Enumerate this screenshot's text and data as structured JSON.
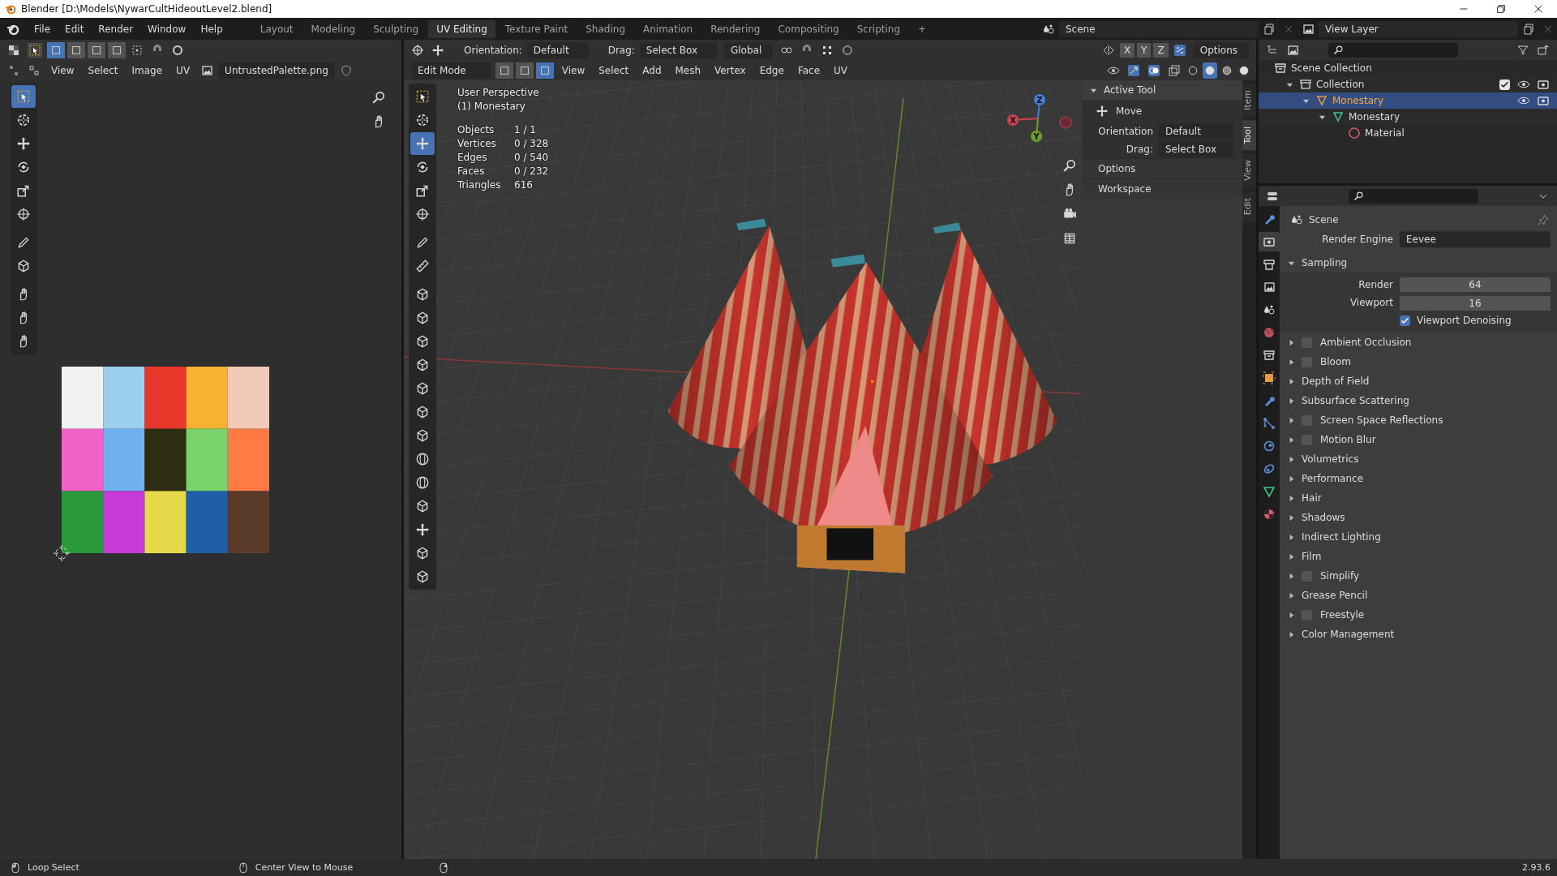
{
  "window": {
    "title": "Blender [D:\\Models\\NywarCultHideoutLevel2.blend]"
  },
  "menu": [
    "File",
    "Edit",
    "Render",
    "Window",
    "Help"
  ],
  "workspaces": [
    {
      "label": "Layout",
      "selected": false
    },
    {
      "label": "Modeling",
      "selected": false
    },
    {
      "label": "Sculpting",
      "selected": false
    },
    {
      "label": "UV Editing",
      "selected": true
    },
    {
      "label": "Texture Paint",
      "selected": false
    },
    {
      "label": "Shading",
      "selected": false
    },
    {
      "label": "Animation",
      "selected": false
    },
    {
      "label": "Rendering",
      "selected": false
    },
    {
      "label": "Compositing",
      "selected": false
    },
    {
      "label": "Scripting",
      "selected": false
    }
  ],
  "add_workspace": "+",
  "scene": "Scene",
  "view_layer": "View Layer",
  "uv_editor": {
    "menu": [
      "View",
      "Select",
      "Image",
      "UV"
    ],
    "image_name": "UntrustedPalette.png",
    "select_modes": [
      {
        "selected": true
      },
      {
        "selected": false
      },
      {
        "selected": false
      },
      {
        "selected": false
      }
    ],
    "tools": [
      {
        "selected": true
      },
      {
        "selected": false
      },
      {
        "selected": false
      },
      {
        "selected": false
      },
      {
        "selected": false
      },
      {
        "selected": false
      },
      {
        "selected": false
      },
      {
        "selected": false
      },
      {
        "selected": false
      },
      {
        "selected": false
      },
      {
        "selected": false
      }
    ]
  },
  "viewport": {
    "orientation_label": "Orientation:",
    "orientation": "Default",
    "drag_label": "Drag:",
    "drag": "Select Box",
    "transform_space": "Global",
    "axes": [
      "X",
      "Y",
      "Z"
    ],
    "options": "Options",
    "mode": "Edit Mode",
    "select_modes": [
      {
        "selected": false
      },
      {
        "selected": false
      },
      {
        "selected": true
      }
    ],
    "menu": [
      "View",
      "Select",
      "Add",
      "Mesh",
      "Vertex",
      "Edge",
      "Face",
      "UV"
    ],
    "shading_modes": [
      {
        "selected": false
      },
      {
        "selected": true
      },
      {
        "selected": false
      },
      {
        "selected": false
      }
    ],
    "overlay": {
      "view": "User Perspective",
      "object": "(1) Monestary",
      "stats": [
        {
          "label": "Objects",
          "value": "1 / 1"
        },
        {
          "label": "Vertices",
          "value": "0 / 328"
        },
        {
          "label": "Edges",
          "value": "0 / 540"
        },
        {
          "label": "Faces",
          "value": "0 / 232"
        },
        {
          "label": "Triangles",
          "value": "616"
        }
      ]
    },
    "tools": [
      {
        "selected": false
      },
      {
        "selected": false
      },
      {
        "selected": true
      },
      {
        "selected": false
      },
      {
        "selected": false
      },
      {
        "selected": false
      },
      {
        "selected": false
      },
      {
        "selected": false
      },
      {
        "selected": false
      },
      {
        "selected": false
      },
      {
        "selected": false
      },
      {
        "selected": false
      },
      {
        "selected": false
      },
      {
        "selected": false
      },
      {
        "selected": false
      },
      {
        "selected": false
      },
      {
        "selected": false
      },
      {
        "selected": false
      },
      {
        "selected": false
      },
      {
        "selected": false
      },
      {
        "selected": false
      }
    ],
    "gizmo": [
      "X",
      "Y",
      "Z"
    ],
    "sidebar": {
      "title": "Active Tool",
      "tool": "Move",
      "orientation_label": "Orientation",
      "orientation": "Default",
      "drag_label": "Drag:",
      "drag": "Select Box",
      "panels": [
        "Options",
        "Workspace"
      ]
    },
    "tabs": [
      {
        "label": "Item",
        "selected": false
      },
      {
        "label": "Tool",
        "selected": true
      },
      {
        "label": "View",
        "selected": false
      },
      {
        "label": "Edit",
        "selected": false
      }
    ]
  },
  "outliner": {
    "root": "Scene Collection",
    "tree": [
      {
        "label": "Collection",
        "kind": "collection",
        "selected": false,
        "expanded": true,
        "checked": true,
        "children": [
          {
            "label": "Monestary",
            "kind": "object",
            "selected": true,
            "expanded": true,
            "children": [
              {
                "label": "Monestary",
                "kind": "mesh",
                "selected": false,
                "expanded": true,
                "children": [
                  {
                    "label": "Material",
                    "kind": "material",
                    "selected": false
                  }
                ]
              }
            ]
          }
        ]
      }
    ]
  },
  "properties": {
    "tabs": [
      {
        "selected": false
      },
      {
        "selected": true
      },
      {
        "selected": false
      },
      {
        "selected": false
      },
      {
        "selected": false
      },
      {
        "selected": false
      },
      {
        "selected": false
      },
      {
        "selected": false
      },
      {
        "selected": false
      },
      {
        "selected": false
      },
      {
        "selected": false
      },
      {
        "selected": false
      },
      {
        "selected": false
      },
      {
        "selected": false
      }
    ],
    "context": "Scene",
    "render_engine_label": "Render Engine",
    "render_engine": "Eevee",
    "sampling": {
      "title": "Sampling",
      "expanded": true,
      "fields": [
        {
          "label": "Render",
          "value": "64"
        },
        {
          "label": "Viewport",
          "value": "16"
        }
      ],
      "denoising": {
        "label": "Viewport Denoising",
        "checked": true
      }
    },
    "panels": [
      {
        "label": "Ambient Occlusion",
        "kind": "toggle",
        "checked": false
      },
      {
        "label": "Bloom",
        "kind": "toggle",
        "checked": false
      },
      {
        "label": "Depth of Field",
        "kind": "plain"
      },
      {
        "label": "Subsurface Scattering",
        "kind": "plain"
      },
      {
        "label": "Screen Space Reflections",
        "kind": "toggle",
        "checked": false
      },
      {
        "label": "Motion Blur",
        "kind": "toggle",
        "checked": false
      },
      {
        "label": "Volumetrics",
        "kind": "plain"
      },
      {
        "label": "Performance",
        "kind": "plain"
      },
      {
        "label": "Hair",
        "kind": "plain"
      },
      {
        "label": "Shadows",
        "kind": "plain"
      },
      {
        "label": "Indirect Lighting",
        "kind": "plain"
      },
      {
        "label": "Film",
        "kind": "plain"
      },
      {
        "label": "Simplify",
        "kind": "toggle",
        "checked": false
      },
      {
        "label": "Grease Pencil",
        "kind": "plain"
      },
      {
        "label": "Freestyle",
        "kind": "toggle",
        "checked": false
      },
      {
        "label": "Color Management",
        "kind": "plain"
      }
    ]
  },
  "status_bar": {
    "items": [
      "Loop Select",
      "Center View to Mouse"
    ],
    "version": "2.93.6"
  }
}
